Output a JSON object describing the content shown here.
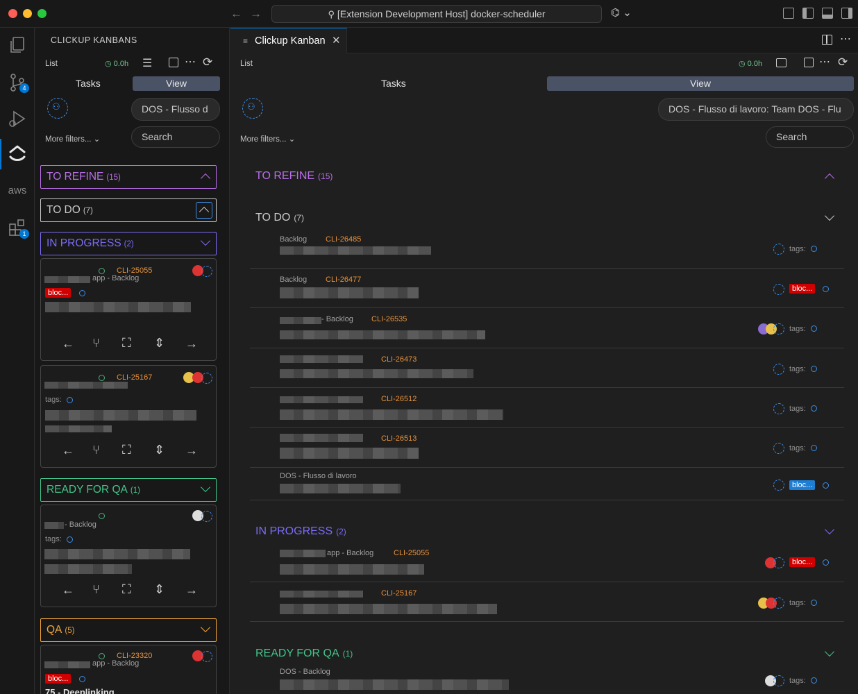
{
  "window": {
    "title": "[Extension Development Host] docker-scheduler"
  },
  "activity_bar": {
    "badges": {
      "source_control": "4",
      "extensions": "1"
    }
  },
  "sidebar": {
    "title": "CLICKUP KANBANS",
    "toolbar": {
      "list_label": "List",
      "time": "0.0h"
    },
    "tasks_label": "Tasks",
    "view_label": "View",
    "workspace_pill": "DOS - Flusso d",
    "more_filters": "More filters...",
    "search_placeholder": "Search",
    "groups": [
      {
        "name": "TO REFINE",
        "count": "(15)",
        "color": "#b96ee8",
        "state": "expanded"
      },
      {
        "name": "TO DO",
        "count": "(7)",
        "color": "#c8c8c8",
        "state": "expanded"
      },
      {
        "name": "IN PROGRESS",
        "count": "(2)",
        "color": "#7b6cf6",
        "state": "collapsed"
      },
      {
        "name": "READY FOR QA",
        "count": "(1)",
        "color": "#43c48a",
        "state": "collapsed"
      },
      {
        "name": "QA",
        "count": "(5)",
        "color": "#f0a33a",
        "state": "collapsed"
      }
    ],
    "cards": [
      {
        "id": "CLI-25055",
        "list": "app - Backlog",
        "tag": "bloc..."
      },
      {
        "id": "CLI-25167",
        "tags_label": "tags:"
      },
      {
        "list": "- Backlog",
        "tags_label": "tags:"
      },
      {
        "id": "CLI-23320",
        "list": "app - Backlog",
        "tag": "bloc...",
        "title": "75 - Deeplinking"
      }
    ]
  },
  "editor": {
    "tab_title": "Clickup Kanban",
    "toolbar": {
      "list_label": "List",
      "time": "0.0h"
    },
    "tasks_label": "Tasks",
    "view_label": "View",
    "workspace_pill": "DOS - Flusso di lavoro: Team DOS - Flu",
    "more_filters": "More filters...",
    "search_placeholder": "Search",
    "groups": {
      "to_refine": {
        "name": "TO REFINE",
        "count": "(15)"
      },
      "to_do": {
        "name": "TO DO",
        "count": "(7)"
      },
      "in_progress": {
        "name": "IN PROGRESS",
        "count": "(2)"
      },
      "ready_for_qa": {
        "name": "READY FOR QA",
        "count": "(1)"
      }
    },
    "todo_rows": [
      {
        "list": "Backlog",
        "id": "CLI-26485",
        "right": "tags:"
      },
      {
        "list": "Backlog",
        "id": "CLI-26477",
        "right": "bloc..."
      },
      {
        "list": "- Backlog",
        "id": "CLI-26535",
        "right": "tags:"
      },
      {
        "list": "",
        "id": "CLI-26473",
        "right": "tags:"
      },
      {
        "list": "",
        "id": "CLI-26512",
        "right": "tags:"
      },
      {
        "list": "",
        "id": "CLI-26513",
        "right": "tags:"
      },
      {
        "list": "DOS - Flusso di lavoro",
        "id": "",
        "right": "bloc..."
      }
    ],
    "inprogress_rows": [
      {
        "list": "app - Backlog",
        "id": "CLI-25055",
        "right": "bloc..."
      },
      {
        "list": "",
        "id": "CLI-25167",
        "right": "tags:"
      }
    ],
    "readyqa_rows": [
      {
        "list": "DOS - Backlog",
        "id": "",
        "right": "tags:"
      }
    ]
  }
}
